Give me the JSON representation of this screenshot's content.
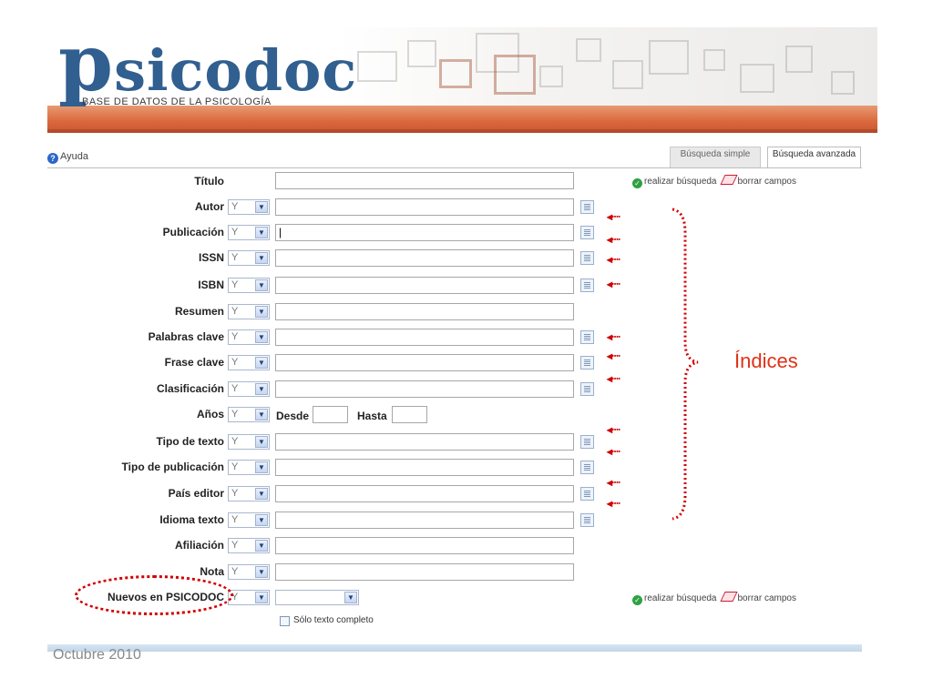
{
  "header": {
    "logo_text": "psicodoc",
    "tagline": "BASE DE DATOS DE LA PSICOLOGÍA"
  },
  "toolbar": {
    "help_label": "Ayuda",
    "tab_simple": "Búsqueda simple",
    "tab_advanced": "Búsqueda avanzada"
  },
  "actions": {
    "search_label": "realizar búsqueda",
    "clear_label": "borrar campos"
  },
  "form": {
    "operator_default": "Y",
    "rows": [
      {
        "label": "Título"
      },
      {
        "label": "Autor"
      },
      {
        "label": "Publicación"
      },
      {
        "label": "ISSN"
      },
      {
        "label": "ISBN"
      },
      {
        "label": "Resumen"
      },
      {
        "label": "Palabras clave"
      },
      {
        "label": "Frase clave"
      },
      {
        "label": "Clasificación"
      },
      {
        "label": "Años"
      },
      {
        "label": "Tipo de texto"
      },
      {
        "label": "Tipo de publicación"
      },
      {
        "label": "País editor"
      },
      {
        "label": "Idioma texto"
      },
      {
        "label": "Afiliación"
      },
      {
        "label": "Nota"
      },
      {
        "label": "Nuevos en PSICODOC"
      }
    ],
    "years_from": "Desde",
    "years_to": "Hasta",
    "fulltext_label": "Sólo texto completo"
  },
  "annotation": {
    "indices_label": "Índices",
    "arrow_glyph": "◂∙∙∙∙"
  },
  "slide_date": "Octubre 2010",
  "colors": {
    "logo_blue": "#315f90",
    "banner_orange": "#dc6a3f",
    "annotation_red": "#e03215"
  }
}
